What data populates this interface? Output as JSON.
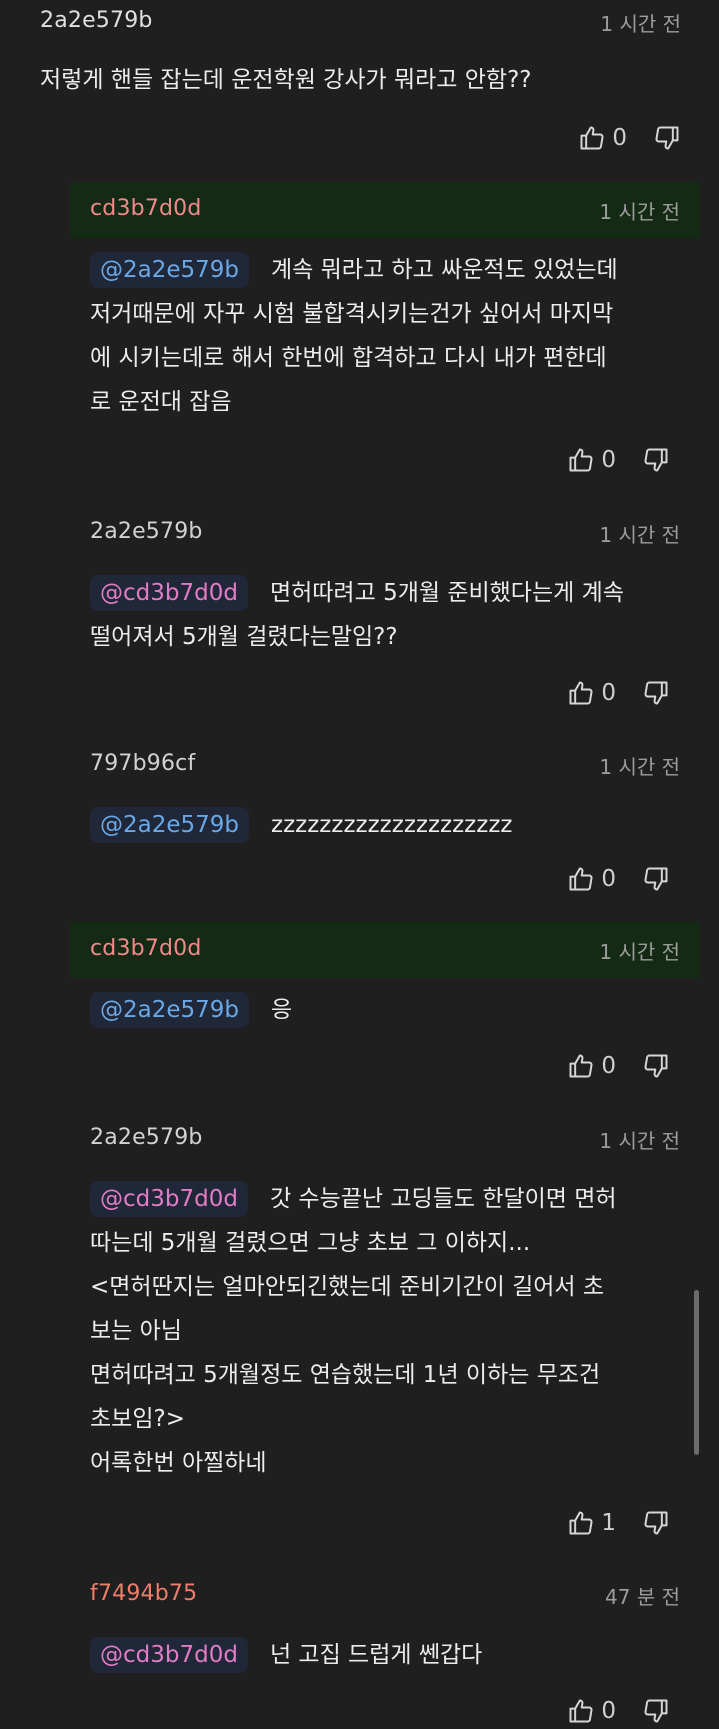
{
  "comments": [
    {
      "author": "2a2e579b",
      "time": "1 시간 전",
      "mention": "",
      "text": "저렇게 핸들 잡는데 운전학원 강사가 뭐라고 안함??",
      "likes": "0"
    },
    {
      "author": "cd3b7d0d",
      "time": "1 시간 전",
      "mention": "@2a2e579b",
      "text": "계속 뭐라고 하고 싸운적도 있었는데\n저거때문에 자꾸 시험 불합격시키는건가 싶어서 마지막\n에 시키는데로 해서 한번에 합격하고 다시 내가 편한데\n로 운전대 잡음",
      "likes": "0"
    },
    {
      "author": "2a2e579b",
      "time": "1 시간 전",
      "mention": "@cd3b7d0d",
      "text": "면허따려고 5개월 준비했다는게 계속\n떨어져서 5개월 걸렸다는말임??",
      "likes": "0"
    },
    {
      "author": "797b96cf",
      "time": "1 시간 전",
      "mention": "@2a2e579b",
      "text": "zzzzzzzzzzzzzzzzzzzz",
      "likes": "0"
    },
    {
      "author": "cd3b7d0d",
      "time": "1 시간 전",
      "mention": "@2a2e579b",
      "text": "응",
      "likes": "0"
    },
    {
      "author": "2a2e579b",
      "time": "1 시간 전",
      "mention": "@cd3b7d0d",
      "text": "갓 수능끝난 고딩들도 한달이면 면허\n따는데 5개월 걸렸으면 그냥 초보 그 이하지...\n<면허딴지는 얼마안되긴했는데 준비기간이 길어서 초\n보는 아님\n면허따려고 5개월정도 연습했는데 1년 이하는 무조건\n초보임?>\n어록한번 아찔하네",
      "likes": "1"
    },
    {
      "author": "f7494b75",
      "time": "47 분 전",
      "mention": "@cd3b7d0d",
      "text": "넌 고집 드럽게 쎈갑다",
      "likes": "0"
    }
  ]
}
